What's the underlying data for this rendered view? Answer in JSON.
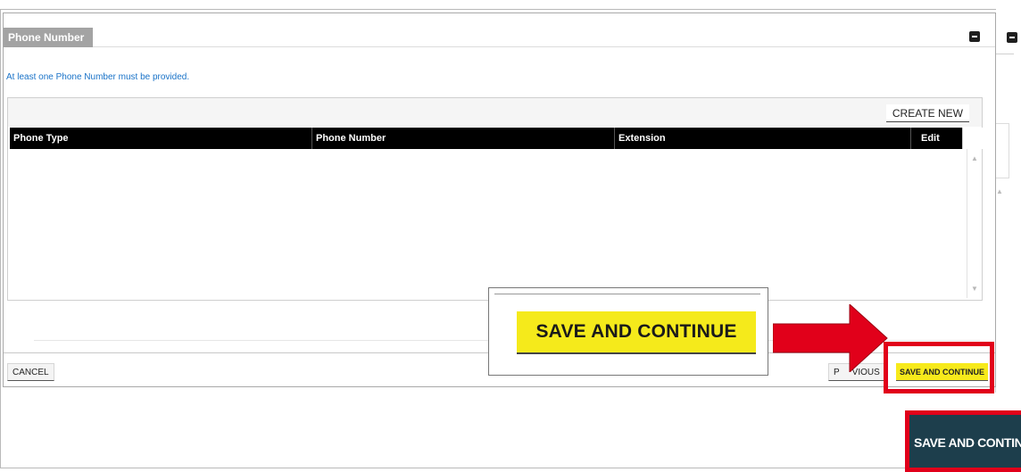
{
  "panel": {
    "tab_title": "Phone Number",
    "notice": "At least one Phone Number must be provided."
  },
  "table": {
    "create_new_label": "CREATE NEW",
    "columns": [
      "Phone Type",
      "Phone Number",
      "Extension",
      "Edit"
    ],
    "rows": []
  },
  "footer": {
    "cancel_label": "CANCEL",
    "previous_label": "PREVIOUS",
    "previous_visible_fragments": [
      "P",
      "VIOUS"
    ],
    "save_label": "SAVE AND CONTINUE"
  },
  "callout": {
    "save_label": "SAVE AND CONTINUE",
    "dark_save_label": "SAVE AND CONTINU"
  },
  "colors": {
    "highlight": "#e1001a",
    "save_button": "#f5ea1b",
    "header_bg": "#000000",
    "tab_bg": "#a3a3a3",
    "notice_text": "#1a73c8",
    "dark_button": "#1d3e4c"
  }
}
